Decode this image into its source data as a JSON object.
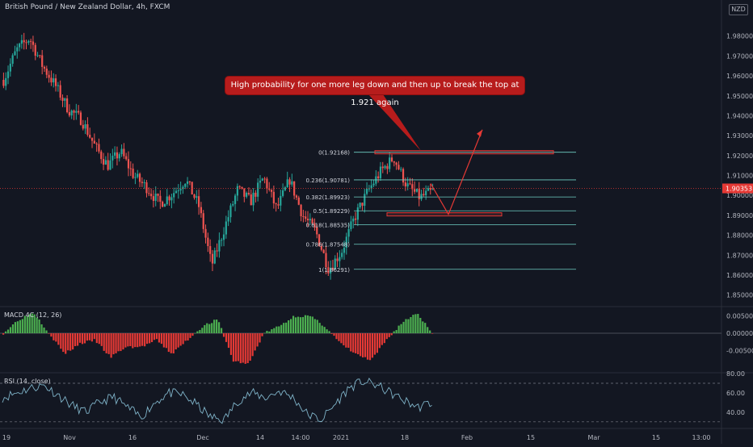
{
  "header": {
    "title": "British Pound / New Zealand Dollar, 4h, FXCM",
    "currency_badge": "NZD"
  },
  "annotation": {
    "text": "High probability for one more leg down and then up to break the top at 1.921 again"
  },
  "indicators": {
    "macd_label": "MACD 4C (12, 26)",
    "rsi_label": "RSI (14, close)"
  },
  "colors": {
    "up": "#26a69a",
    "down": "#ef5350",
    "hist_up": "#4caf50",
    "hist_down": "#e53935",
    "fib": "#6fd0c4",
    "annot": "#e53935",
    "grid": "#1e222d",
    "text": "#b2b5be",
    "rsi": "#7fb3c8",
    "price_badge": "#e53935"
  },
  "chart_data": {
    "type": "candlestick",
    "x_axis": {
      "ticks": [
        "19",
        "Nov",
        "16",
        "Dec",
        "14",
        "14:00",
        "2021",
        "18",
        "Feb",
        "15",
        "Mar",
        "15",
        "13:00"
      ]
    },
    "price": {
      "ylim": [
        1.845,
        1.99
      ],
      "ticks": [
        "1.98000",
        "1.97000",
        "1.96000",
        "1.95000",
        "1.94000",
        "1.93000",
        "1.92000",
        "1.91000",
        "1.90000",
        "1.89000",
        "1.88000",
        "1.87000",
        "1.86000",
        "1.85000"
      ],
      "current": "1.90353",
      "path": [
        1.958,
        1.973,
        1.979,
        1.965,
        1.955,
        1.943,
        1.938,
        1.925,
        1.915,
        1.922,
        1.91,
        1.904,
        1.896,
        1.901,
        1.908,
        1.895,
        1.865,
        1.884,
        1.903,
        1.897,
        1.909,
        1.893,
        1.908,
        1.89,
        1.882,
        1.863,
        1.872,
        1.889,
        1.902,
        1.912,
        1.919,
        1.905,
        1.899,
        1.902
      ]
    },
    "fibonacci": [
      {
        "label": "0(1.92168)",
        "value": 1.92168
      },
      {
        "label": "0.236(1.90781)",
        "value": 1.90781
      },
      {
        "label": "0.382(1.89923)",
        "value": 1.89923
      },
      {
        "label": "0.5(1.89229)",
        "value": 1.89229
      },
      {
        "label": "0.618(1.88535)",
        "value": 1.88535
      },
      {
        "label": "0.786(1.87548)",
        "value": 1.87548
      },
      {
        "label": "1(1.86291)",
        "value": 1.86291
      }
    ],
    "macd": {
      "ylim": [
        -0.011,
        0.0075
      ],
      "ticks": [
        "0.00500",
        "0.00000",
        "-0.00500"
      ],
      "path": [
        0.0,
        0.004,
        0.006,
        0.0,
        -0.006,
        -0.003,
        -0.002,
        -0.007,
        -0.004,
        -0.004,
        -0.002,
        -0.006,
        -0.002,
        0.002,
        0.004,
        -0.008,
        -0.009,
        0.0,
        0.002,
        0.005,
        0.005,
        0.002,
        -0.003,
        -0.006,
        -0.008,
        -0.002,
        0.003,
        0.006,
        0.0
      ]
    },
    "rsi": {
      "ylim": [
        24,
        80
      ],
      "ticks": [
        "80.00",
        "60.00",
        "40.00"
      ],
      "bands": [
        70,
        30
      ],
      "path": [
        55,
        60,
        65,
        68,
        58,
        47,
        40,
        50,
        56,
        45,
        35,
        50,
        60,
        58,
        48,
        35,
        32,
        52,
        60,
        55,
        62,
        55,
        38,
        32,
        48,
        65,
        72,
        68,
        60,
        52,
        45,
        50
      ]
    }
  }
}
